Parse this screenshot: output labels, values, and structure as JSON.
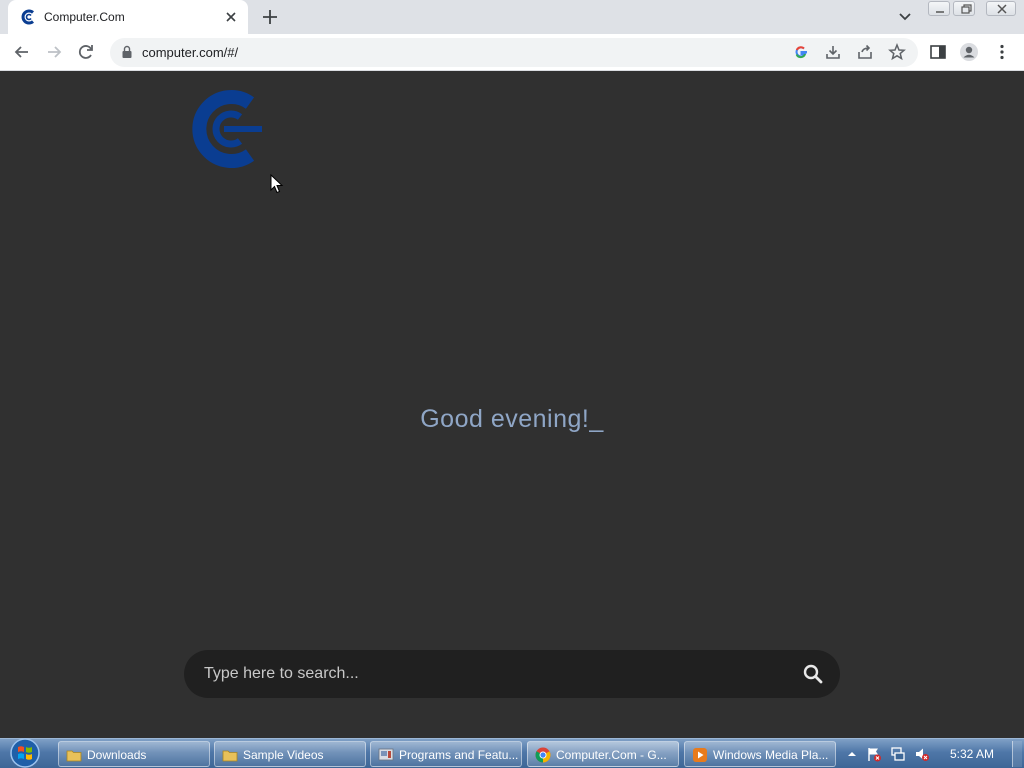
{
  "browser": {
    "tab": {
      "title": "Computer.Com"
    },
    "url": "computer.com/#/"
  },
  "page": {
    "greeting": "Good evening!_",
    "search": {
      "placeholder": "Type here to search...",
      "value": ""
    }
  },
  "taskbar": {
    "items": [
      {
        "label": "Downloads",
        "icon": "folder-icon"
      },
      {
        "label": "Sample Videos",
        "icon": "folder-icon"
      },
      {
        "label": "Programs and Featu...",
        "icon": "control-panel-icon"
      },
      {
        "label": "Computer.Com - G...",
        "icon": "chrome-icon"
      },
      {
        "label": "Windows Media Pla...",
        "icon": "media-player-icon"
      }
    ],
    "clock": "5:32 AM"
  },
  "colors": {
    "page_bg": "#303030",
    "greeting": "#8fa6c6",
    "search_bg": "#202020",
    "logo_blue": "#0a3d91"
  }
}
